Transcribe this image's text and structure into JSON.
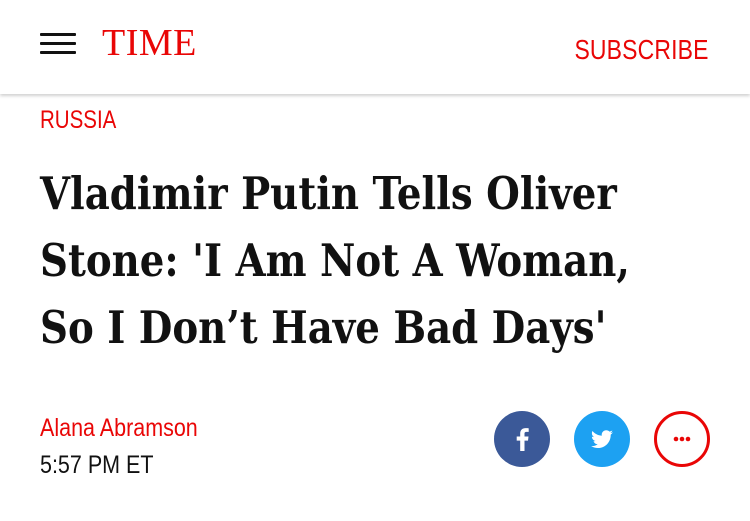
{
  "header": {
    "logo": "TIME",
    "subscribe_label": "SUBSCRIBE"
  },
  "icons": {
    "menu": "hamburger-menu-icon",
    "facebook": "facebook-icon",
    "twitter": "twitter-icon",
    "more": "more-dots-icon"
  },
  "article": {
    "section": "RUSSIA",
    "headline_lines": [
      "Vladimir Putin Tells Oliver",
      "Stone: 'I Am Not A Woman,",
      "So I Don’t Have Bad Days'"
    ],
    "author": "Alana Abramson",
    "time": "5:57 PM ET"
  },
  "colors": {
    "brand_red": "#e90606",
    "facebook_blue": "#3b5998",
    "twitter_blue": "#1da1f2",
    "text": "#111111"
  }
}
